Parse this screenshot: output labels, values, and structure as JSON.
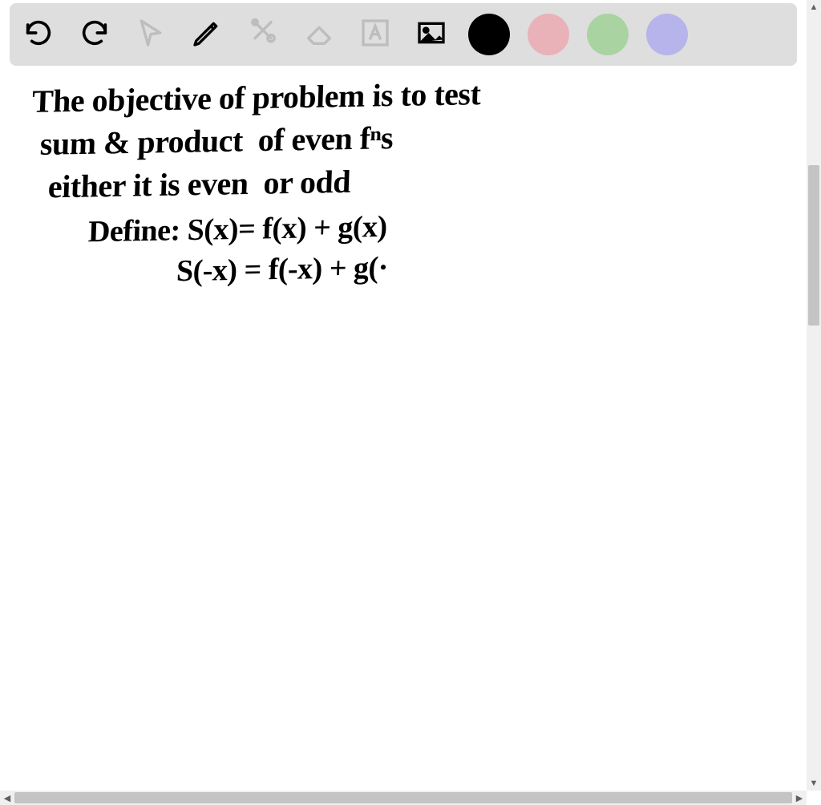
{
  "toolbar": {
    "tools": [
      {
        "name": "undo-icon"
      },
      {
        "name": "redo-icon"
      },
      {
        "name": "pointer-icon"
      },
      {
        "name": "pencil-icon"
      },
      {
        "name": "tools-icon"
      },
      {
        "name": "eraser-icon"
      },
      {
        "name": "text-icon"
      },
      {
        "name": "image-icon"
      }
    ],
    "colors": [
      {
        "name": "color-black",
        "hex": "#000000"
      },
      {
        "name": "color-pink",
        "hex": "#e8b2b8"
      },
      {
        "name": "color-green",
        "hex": "#a9d4a1"
      },
      {
        "name": "color-purple",
        "hex": "#b6b4ea"
      }
    ]
  },
  "canvas": {
    "lines": {
      "l1": "The objective of problem is to test",
      "l2": "sum & product  of even fⁿs",
      "l3": "either it is even  or odd",
      "l4": "Define: S(x)= f(x) + g(x)",
      "l5": "S(-x) = f(-x) + g(·"
    }
  },
  "scroll": {
    "up": "▲",
    "down": "▼",
    "left": "◀",
    "right": "▶"
  }
}
